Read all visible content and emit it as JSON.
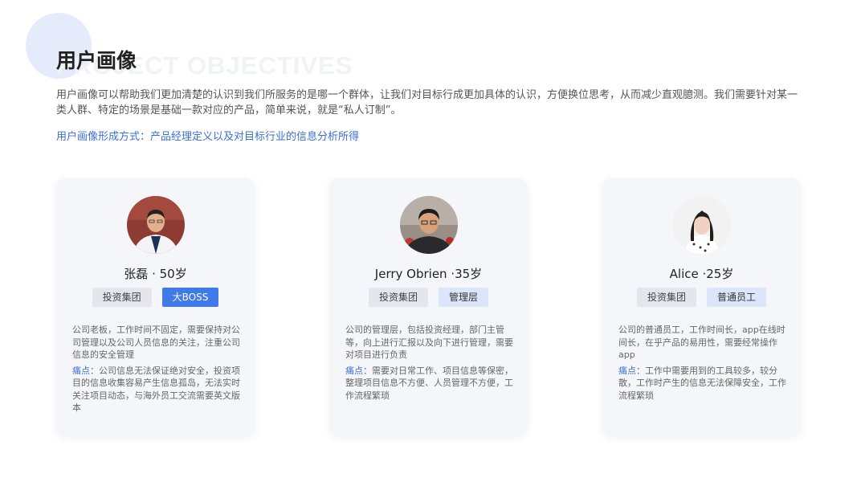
{
  "header": {
    "watermark": "PROJECT OBJECTIVES",
    "title": "用户画像",
    "intro": "用户画像可以帮助我们更加清楚的认识到我们所服务的是哪一个群体，让我们对目标行成更加具体的认识，方便换位思考，从而减少直观臆测。我们需要针对某一类人群、特定的场景是基础一款对应的产品，简单来说，就是“私人订制”。",
    "method": "用户画像形成方式：产品经理定义以及对目标行业的信息分析所得"
  },
  "personas": [
    {
      "name": "张磊 · 50岁",
      "tag1": "投资集团",
      "tag2": "大BOSS",
      "description": "公司老板，工作时间不固定，需要保持对公司管理以及公司人员信息的关注，注重公司信息的安全管理",
      "pain_label": "痛点",
      "pain_text": "：公司信息无法保证绝对安全，投资项目的信息收集容易产生信息孤岛，无法实时关注项目动态，与海外员工交流需要英文版本"
    },
    {
      "name": "Jerry Obrien ·35岁",
      "tag1": "投资集团",
      "tag2": "管理层",
      "description": "公司的管理层，包括投资经理，部门主管等，向上进行汇报以及向下进行管理，需要对项目进行负责",
      "pain_label": "痛点",
      "pain_text": "：需要对日常工作、项目信息等保密，整理项目信息不方便、人员管理不方便，工作流程繁琐"
    },
    {
      "name": "Alice ·25岁",
      "tag1": "投资集团",
      "tag2": "普通员工",
      "description": "公司的普通员工，工作时间长，app在线时间长，在乎产品的易用性，需要经常操作app",
      "pain_label": "痛点",
      "pain_text": "：工作中需要用到的工具较多，较分散，工作时产生的信息无法保障安全，工作流程繁琐"
    }
  ],
  "colors": {
    "accent": "#3f7ae8",
    "pain_label": "#3b6fd8",
    "card_bg": "#f5f6fa"
  }
}
